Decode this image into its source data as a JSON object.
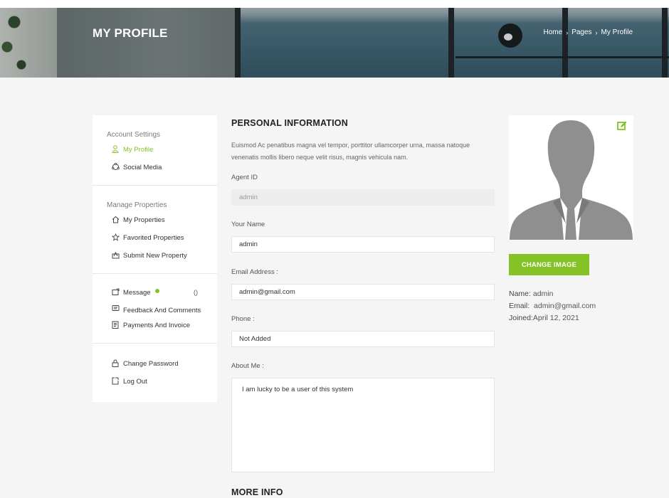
{
  "header": {
    "title": "MY PROFILE",
    "breadcrumb": [
      "Home",
      "Pages",
      "My Profile"
    ]
  },
  "sidebar": {
    "sections": [
      {
        "heading": "Account Settings",
        "items": [
          {
            "label": "My Profile",
            "icon": "user-icon",
            "active": true
          },
          {
            "label": "Social Media",
            "icon": "share-icon"
          }
        ]
      },
      {
        "heading": "Manage Properties",
        "items": [
          {
            "label": "My Properties",
            "icon": "home-icon"
          },
          {
            "label": "Favorited Properties",
            "icon": "star-icon"
          },
          {
            "label": "Submit New Property",
            "icon": "upload-icon"
          }
        ]
      },
      {
        "heading": "",
        "items": [
          {
            "label": "Message",
            "icon": "message-icon",
            "count": "()"
          },
          {
            "label": "Feedback And Comments",
            "icon": "feedback-icon"
          },
          {
            "label": "Payments And Invoice",
            "icon": "invoice-icon"
          }
        ]
      },
      {
        "heading": "",
        "items": [
          {
            "label": "Change Password",
            "icon": "lock-icon"
          },
          {
            "label": "Log Out",
            "icon": "logout-icon"
          }
        ]
      }
    ]
  },
  "main": {
    "section_title": "PERSONAL INFORMATION",
    "intro": "Euismod Ac penatibus magna vel tempor, porttitor ullamcorper urna, massa natoque venenatis mollis libero neque velit risus, magnis vehicula nam.",
    "fields": {
      "agent_id": {
        "label": "Agent ID",
        "value": "admin"
      },
      "name": {
        "label": "Your Name",
        "value": "admin"
      },
      "email": {
        "label": "Email Address :",
        "value": "admin@gmail.com"
      },
      "phone": {
        "label": "Phone :",
        "value": "Not Added"
      },
      "about": {
        "label": "About Me :",
        "value": "I am lucky to be a user of this system"
      }
    },
    "more_info_title": "MORE INFO"
  },
  "profile": {
    "change_image_label": "CHANGE IMAGE",
    "name_key": "Name:",
    "name_value": "admin",
    "email_key": "Email:",
    "email_value": "admin@gmail.com",
    "joined_key": "Joined:",
    "joined_value": "April 12, 2021"
  },
  "colors": {
    "accent": "#84c225",
    "page_bg": "#f5f5f5"
  }
}
